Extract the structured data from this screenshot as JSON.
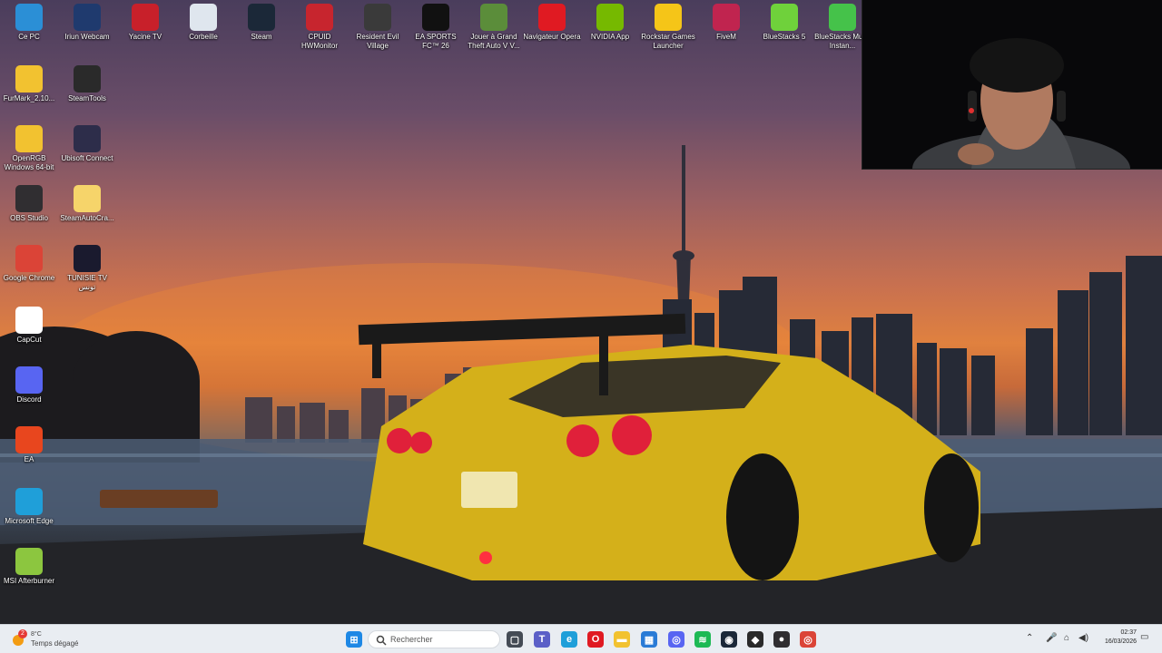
{
  "desktop": {
    "icons": [
      {
        "label": "Ce PC",
        "icon": "computer-icon",
        "color": "#2b8fd6"
      },
      {
        "label": "Iriun Webcam",
        "icon": "webcam-icon",
        "color": "#1f3a6e"
      },
      {
        "label": "Yacine TV",
        "icon": "tv-icon",
        "color": "#c8202a"
      },
      {
        "label": "Corbeille",
        "icon": "recycle-bin-icon",
        "color": "#dfe6ee"
      },
      {
        "label": "Steam",
        "icon": "steam-icon",
        "color": "#1b2838"
      },
      {
        "label": "CPUID HWMonitor",
        "icon": "hwmonitor-icon",
        "color": "#c7252e"
      },
      {
        "label": "Resident Evil Village",
        "icon": "resident-evil-icon",
        "color": "#3a3a3a"
      },
      {
        "label": "EA SPORTS FC™ 26",
        "icon": "ea-fc-icon",
        "color": "#111111"
      },
      {
        "label": "Jouer à Grand Theft Auto V V...",
        "icon": "gta-icon",
        "color": "#5b8d3a"
      },
      {
        "label": "Navigateur Opera",
        "icon": "opera-icon",
        "color": "#e01a22"
      },
      {
        "label": "NVIDIA App",
        "icon": "nvidia-icon",
        "color": "#76b900"
      },
      {
        "label": "Rockstar Games Launcher",
        "icon": "rockstar-icon",
        "color": "#f5c518"
      },
      {
        "label": "FiveM",
        "icon": "fivem-icon",
        "color": "#c0244f"
      },
      {
        "label": "BlueStacks 5",
        "icon": "bluestacks-icon",
        "color": "#6fd13b"
      },
      {
        "label": "BlueStacks Multi-Instan...",
        "icon": "bluestacks-multi-icon",
        "color": "#45c24a"
      },
      {
        "label": "FurMark_2.10...",
        "icon": "folder-icon",
        "color": "#f2c230"
      },
      {
        "label": "SteamTools",
        "icon": "steamtools-icon",
        "color": "#2a2a2a"
      },
      {
        "label": "OpenRGB Windows 64-bit",
        "icon": "folder-icon",
        "color": "#f2c230"
      },
      {
        "label": "Ubisoft Connect",
        "icon": "ubisoft-icon",
        "color": "#2d2d4a"
      },
      {
        "label": "OBS Studio",
        "icon": "obs-icon",
        "color": "#302e31"
      },
      {
        "label": "SteamAutoCra...",
        "icon": "folder-icon",
        "color": "#f6d46a"
      },
      {
        "label": "Google Chrome",
        "icon": "chrome-icon",
        "color": "#db4437"
      },
      {
        "label": "TUNISIE TV تونس",
        "icon": "tunisie-tv-icon",
        "color": "#1a1a2e"
      },
      {
        "label": "CapCut",
        "icon": "capcut-icon",
        "color": "#ffffff"
      },
      {
        "label": "Discord",
        "icon": "discord-icon",
        "color": "#5865f2"
      },
      {
        "label": "EA",
        "icon": "ea-icon",
        "color": "#e8461e"
      },
      {
        "label": "Microsoft Edge",
        "icon": "edge-icon",
        "color": "#1f9fd9"
      },
      {
        "label": "MSI Afterburner",
        "icon": "afterburner-icon",
        "color": "#8cc63f"
      }
    ]
  },
  "taskbar": {
    "weather_badge": "2",
    "weather_temp": "8°C",
    "weather_desc": "Temps dégagé",
    "search_placeholder": "Rechercher",
    "pinned": [
      {
        "icon": "windows-start-icon",
        "color": "#1e88e5",
        "glyph": "⊞"
      },
      {
        "icon": "task-view-icon",
        "color": "#444b55",
        "glyph": "▢"
      },
      {
        "icon": "teams-icon",
        "color": "#5b5fc7",
        "glyph": "T"
      },
      {
        "icon": "edge-taskbar-icon",
        "color": "#1f9fd9",
        "glyph": "e"
      },
      {
        "icon": "opera-taskbar-icon",
        "color": "#e01a22",
        "glyph": "O"
      },
      {
        "icon": "file-explorer-icon",
        "color": "#f2c230",
        "glyph": "▬"
      },
      {
        "icon": "microsoft-store-icon",
        "color": "#2a7bd6",
        "glyph": "▦"
      },
      {
        "icon": "discord-taskbar-icon",
        "color": "#5865f2",
        "glyph": "◎"
      },
      {
        "icon": "spotify-icon",
        "color": "#1db954",
        "glyph": "≋"
      },
      {
        "icon": "steam-taskbar-icon",
        "color": "#1b2838",
        "glyph": "◉"
      },
      {
        "icon": "nvidia-taskbar-icon",
        "color": "#2a2a2a",
        "glyph": "◆"
      },
      {
        "icon": "obs-taskbar-icon",
        "color": "#302e31",
        "glyph": "●"
      },
      {
        "icon": "chrome-taskbar-icon",
        "color": "#db4437",
        "glyph": "◎"
      }
    ],
    "time": "02:37",
    "date": "16/03/2026"
  }
}
